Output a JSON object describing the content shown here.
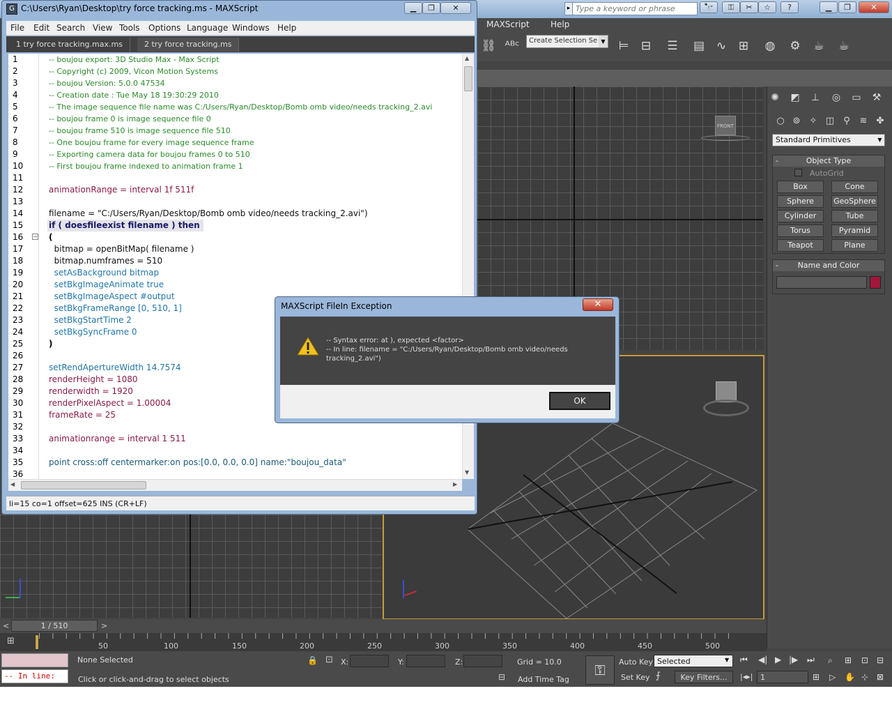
{
  "max": {
    "menus": [
      "MAXScript",
      "Help"
    ],
    "selection_set_placeholder": "Create Selection Se",
    "search_placeholder": "Type a keyword or phrase",
    "viewcube_label": "FRONT",
    "command_panel": {
      "category": "Standard Primitives",
      "object_type_title": "Object Type",
      "autogrid_label": "AutoGrid",
      "buttons": [
        "Box",
        "Cone",
        "Sphere",
        "GeoSphere",
        "Cylinder",
        "Tube",
        "Torus",
        "Pyramid",
        "Teapot",
        "Plane"
      ],
      "name_color_title": "Name and Color",
      "object_color": "#a0173a"
    },
    "time_slider": {
      "label": "1 / 510",
      "prev": "<",
      "next": ">"
    },
    "ruler_ticks": [
      "50",
      "100",
      "150",
      "200",
      "250",
      "300",
      "350",
      "400",
      "450",
      "500"
    ],
    "status": {
      "listener_line1": "",
      "listener_line2": "-- In line:",
      "selection": "None Selected",
      "prompt": "Click or click-and-drag to select objects",
      "x_label": "X:",
      "y_label": "Y:",
      "z_label": "Z:",
      "grid": "Grid = 10.0",
      "add_time_tag": "Add Time Tag",
      "auto_key": "Auto Key",
      "set_key": "Set Key",
      "key_mode": "Selected",
      "key_filters": "Key Filters...",
      "current_frame": "1"
    }
  },
  "editor": {
    "title": "C:\\Users\\Ryan\\Desktop\\try force tracking.ms - MAXScript",
    "menus": [
      "File",
      "Edit",
      "Search",
      "View",
      "Tools",
      "Options",
      "Language",
      "Windows",
      "Help"
    ],
    "tabs": [
      "1 try force tracking.max.ms",
      "2 try force tracking.ms"
    ],
    "line_numbers": [
      "1",
      "2",
      "3",
      "4",
      "5",
      "6",
      "7",
      "8",
      "9",
      "10",
      "11",
      "12",
      "13",
      "14",
      "15",
      "16",
      "17",
      "18",
      "19",
      "20",
      "21",
      "22",
      "23",
      "24",
      "25",
      "26",
      "27",
      "28",
      "29",
      "30",
      "31",
      "32",
      "33",
      "34",
      "35",
      "36"
    ],
    "lines": [
      "-- boujou export: 3D Studio Max - Max Script",
      "-- Copyright (c) 2009, Vicon Motion Systems",
      "-- boujou Version: 5.0.0 47534",
      "-- Creation date : Tue May 18 19:30:29 2010",
      "-- The image sequence file name was C:/Users/Ryan/Desktop/Bomb omb video/needs tracking_2.avi",
      "-- boujou frame 0 is image sequence file 0",
      "-- boujou frame 510 is image sequence file 510",
      "-- One boujou frame for every image sequence frame",
      "-- Exporting camera data for boujou frames 0 to 510",
      "-- First boujou frame indexed to animation frame 1",
      "",
      "animationRange = interval 1f 511f",
      "",
      "filename = \"C:/Users/Ryan/Desktop/Bomb omb video/needs tracking_2.avi\")",
      "if ( doesfileexist filename ) then",
      "(",
      "  bitmap = openBitMap( filename )",
      "  bitmap.numframes = 510",
      "  setAsBackground bitmap",
      "  setBkgImageAnimate true",
      "  setBkgImageAspect #output",
      "  setBkgFrameRange [0, 510, 1]",
      "  setBkgStartTime 2",
      "  setBkgSyncFrame 0",
      ")",
      "",
      "setRendApertureWidth 14.7574",
      "renderHeight = 1080",
      "renderwidth = 1920",
      "renderPixelAspect = 1.00004",
      "frameRate = 25",
      "",
      "animationrange = interval 1 511",
      "",
      "point cross:off centermarker:on pos:[0.0, 0.0, 0.0] name:\"boujou_data\"",
      ""
    ],
    "status": "li=15 co=1 offset=625 INS (CR+LF)"
  },
  "dialog": {
    "title": "MAXScript FileIn Exception",
    "close": "✕",
    "message_line1": "-- Syntax error: at ), expected <factor>",
    "message_line2": "--  In line: filename = \"C:/Users/Ryan/Desktop/Bomb omb video/needs",
    "message_line3": "tracking_2.avi\")",
    "ok": "OK"
  }
}
